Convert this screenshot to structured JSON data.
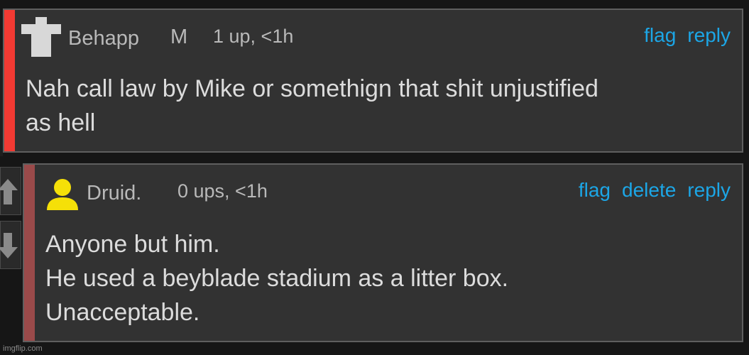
{
  "comments": [
    {
      "username": "Behapp",
      "badge": "M",
      "meta": "1 up, <1h",
      "actions": [
        "flag",
        "reply"
      ],
      "avatar_icon": "cross-avatar-icon",
      "bar_color": "#f23a33",
      "lines": [
        "Nah call law by Mike or somethign that shit unjustified",
        "as hell"
      ]
    },
    {
      "username": "Druid.",
      "meta": "0 ups, <1h",
      "actions": [
        "flag",
        "delete",
        "reply"
      ],
      "avatar_icon": "user-avatar-icon",
      "avatar_color": "#f5e008",
      "bar_color": "#9a4a4a",
      "lines": [
        "Anyone but him.",
        "He used a beyblade stadium as a litter box.",
        "Unacceptable."
      ]
    }
  ],
  "votes": {
    "up_icon": "upvote-arrow-icon",
    "down_icon": "downvote-arrow-icon"
  },
  "watermark": "imgflip.com",
  "colors": {
    "link": "#1ca6e6",
    "panel": "#323232",
    "text": "#dcdcdc",
    "meta": "#b9b9b9"
  }
}
